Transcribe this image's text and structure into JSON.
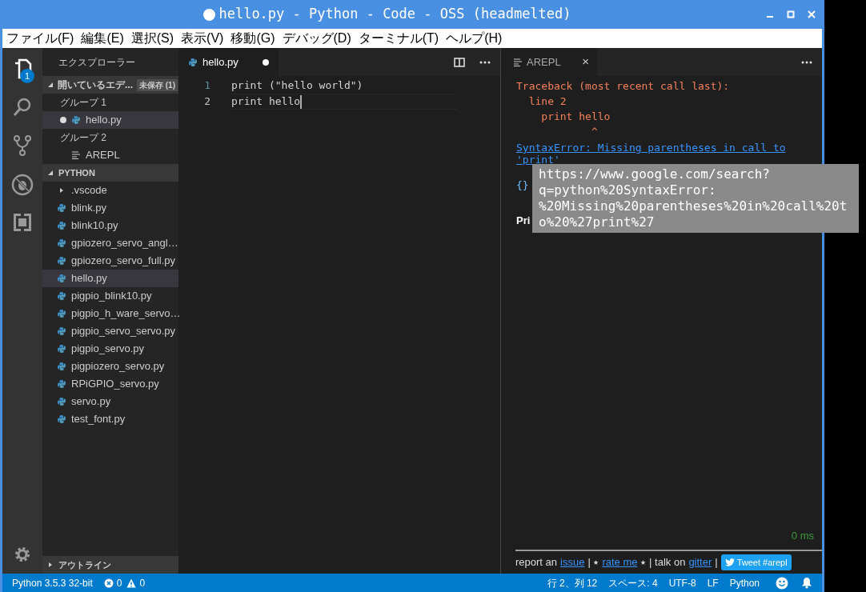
{
  "window": {
    "title": "hello.py - Python - Code - OSS (headmelted)",
    "modified": true
  },
  "menu": [
    "ファイル(F)",
    "編集(E)",
    "選択(S)",
    "表示(V)",
    "移動(G)",
    "デバッグ(D)",
    "ターミナル(T)",
    "ヘルプ(H)"
  ],
  "activity_bar": {
    "badge": "1"
  },
  "sidebar": {
    "title": "エクスプローラー",
    "open_editors": {
      "label": "開いているエデ...",
      "badge": "未保存 (1)",
      "expanded": true,
      "groups": [
        {
          "label": "グループ 1",
          "items": [
            {
              "name": "hello.py",
              "kind": "python",
              "modified": true,
              "selected": true
            }
          ]
        },
        {
          "label": "グループ 2",
          "items": [
            {
              "name": "AREPL",
              "kind": "preview",
              "modified": false,
              "selected": false
            }
          ]
        }
      ]
    },
    "folder": {
      "label": "PYTHON",
      "expanded": true,
      "items": [
        {
          "name": ".vscode",
          "kind": "folder",
          "expanded": false,
          "selected": false
        },
        {
          "name": "blink.py",
          "kind": "python",
          "selected": false
        },
        {
          "name": "blink10.py",
          "kind": "python",
          "selected": false
        },
        {
          "name": "gpiozero_servo_angl…",
          "kind": "python",
          "selected": false
        },
        {
          "name": "gpiozero_servo_full.py",
          "kind": "python",
          "selected": false
        },
        {
          "name": "hello.py",
          "kind": "python",
          "selected": true
        },
        {
          "name": "pigpio_blink10.py",
          "kind": "python",
          "selected": false
        },
        {
          "name": "pigpio_h_ware_servo…",
          "kind": "python",
          "selected": false
        },
        {
          "name": "pigpio_servo_servo.py",
          "kind": "python",
          "selected": false
        },
        {
          "name": "pigpio_servo.py",
          "kind": "python",
          "selected": false
        },
        {
          "name": "pigpiozero_servo.py",
          "kind": "python",
          "selected": false
        },
        {
          "name": "RPiGPIO_servo.py",
          "kind": "python",
          "selected": false
        },
        {
          "name": "servo.py",
          "kind": "python",
          "selected": false
        },
        {
          "name": "test_font.py",
          "kind": "python",
          "selected": false
        }
      ]
    },
    "outline": {
      "label": "アウトライン",
      "expanded": false
    }
  },
  "editor": {
    "tab": {
      "name": "hello.py",
      "modified": true
    },
    "lines": [
      {
        "number": "1",
        "code": "print (\"hello world\")",
        "current": false
      },
      {
        "number": "2",
        "code": "print hello",
        "current": true
      }
    ]
  },
  "arepl": {
    "tab": "AREPL",
    "close": "×",
    "traceback": [
      "Traceback (most recent call last):",
      "  line 2",
      "    print hello",
      "            ^"
    ],
    "error_link": "SyntaxError: Missing parentheses in call to",
    "error_link_2": "'print'",
    "braces": "{}",
    "print_heading": "Pri",
    "tooltip": [
      "https://www.google.com/search?",
      "q=python%20SyntaxError:",
      "%20Missing%20parentheses%20in%20call%20t",
      "o%20%27print%27"
    ],
    "timing": "0 ms",
    "footer": {
      "report": "report an",
      "issue": "issue",
      "sep1": "| ⭑",
      "rate": "rate me",
      "sep2": "⭑ | talk on",
      "gitter": "gitter",
      "sep3": "|",
      "tweet": "Tweet #arepl"
    }
  },
  "status_bar": {
    "interpreter": "Python 3.5.3 32-bit",
    "errors": "0",
    "warnings": "0",
    "position": "行 2、列 12",
    "spaces": "スペース: 4",
    "encoding": "UTF-8",
    "eol": "LF",
    "language": "Python"
  }
}
